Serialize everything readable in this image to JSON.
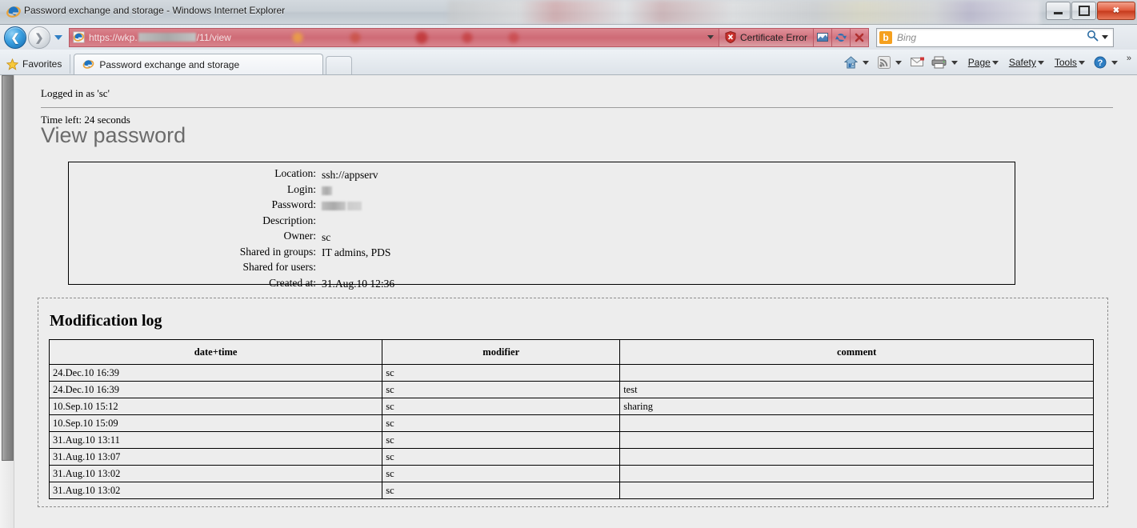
{
  "window": {
    "title": "Password exchange and storage - Windows Internet Explorer",
    "icon": "ie-logo-icon",
    "minimize_label": "Minimize",
    "maximize_label": "Maximize",
    "close_label": "Close"
  },
  "navigation": {
    "back_label": "Back",
    "forward_label": "Forward",
    "recent_pages_label": "Recent Pages",
    "url_prefix": "https://wkp.",
    "url_suffix": "/11/view",
    "url_full": "https://wkp.██████/11/view",
    "certificate_error": "Certificate Error",
    "compat_view_label": "Compatibility View",
    "refresh_label": "Refresh",
    "stop_label": "Stop"
  },
  "search": {
    "provider": "Bing",
    "placeholder": "Bing",
    "logo_letter": "b",
    "go_label": "Search"
  },
  "tabbar": {
    "favorites_label": "Favorites",
    "tabs": [
      {
        "label": "Password exchange and storage",
        "icon": "ie-page-icon",
        "active": true
      }
    ],
    "new_tab_label": "New Tab"
  },
  "commandbar": {
    "icons": [
      "home-icon",
      "feeds-icon",
      "mail-icon",
      "print-icon"
    ],
    "menus": [
      "Page",
      "Safety",
      "Tools"
    ],
    "help_label": "Help",
    "overflow_label": "More"
  },
  "page": {
    "logged_in": "Logged in as 'sc'",
    "time_left": "Time left: 24 seconds",
    "heading": "View password",
    "details": [
      {
        "label": "Location:",
        "value": "ssh://appserv",
        "redacted": false
      },
      {
        "label": "Login:",
        "value": "",
        "redacted": "login"
      },
      {
        "label": "Password:",
        "value": "",
        "redacted": "password"
      },
      {
        "label": "Description:",
        "value": "",
        "redacted": false
      },
      {
        "label": "Owner:",
        "value": "sc",
        "redacted": false
      },
      {
        "label": "Shared in groups:",
        "value": "IT admins, PDS",
        "redacted": false
      },
      {
        "label": "Shared for users:",
        "value": "",
        "redacted": false
      },
      {
        "label": "Created at:",
        "value": "31.Aug.10 12:36",
        "redacted": false
      }
    ],
    "log": {
      "title": "Modification log",
      "columns": [
        "date+time",
        "modifier",
        "comment"
      ],
      "rows": [
        {
          "datetime": "24.Dec.10 16:39",
          "modifier": "sc",
          "comment": ""
        },
        {
          "datetime": "24.Dec.10 16:39",
          "modifier": "sc",
          "comment": "test"
        },
        {
          "datetime": "10.Sep.10 15:12",
          "modifier": "sc",
          "comment": "sharing"
        },
        {
          "datetime": "10.Sep.10 15:09",
          "modifier": "sc",
          "comment": ""
        },
        {
          "datetime": "31.Aug.10 13:11",
          "modifier": "sc",
          "comment": ""
        },
        {
          "datetime": "31.Aug.10 13:07",
          "modifier": "sc",
          "comment": ""
        },
        {
          "datetime": "31.Aug.10 13:02",
          "modifier": "sc",
          "comment": ""
        },
        {
          "datetime": "31.Aug.10 13:02",
          "modifier": "sc",
          "comment": ""
        }
      ]
    }
  },
  "colors": {
    "cert_error_red": "#cf6b76",
    "heading_gray": "#6b6b6b",
    "page_bg": "#ededed",
    "bing_orange": "#f5a01e"
  }
}
